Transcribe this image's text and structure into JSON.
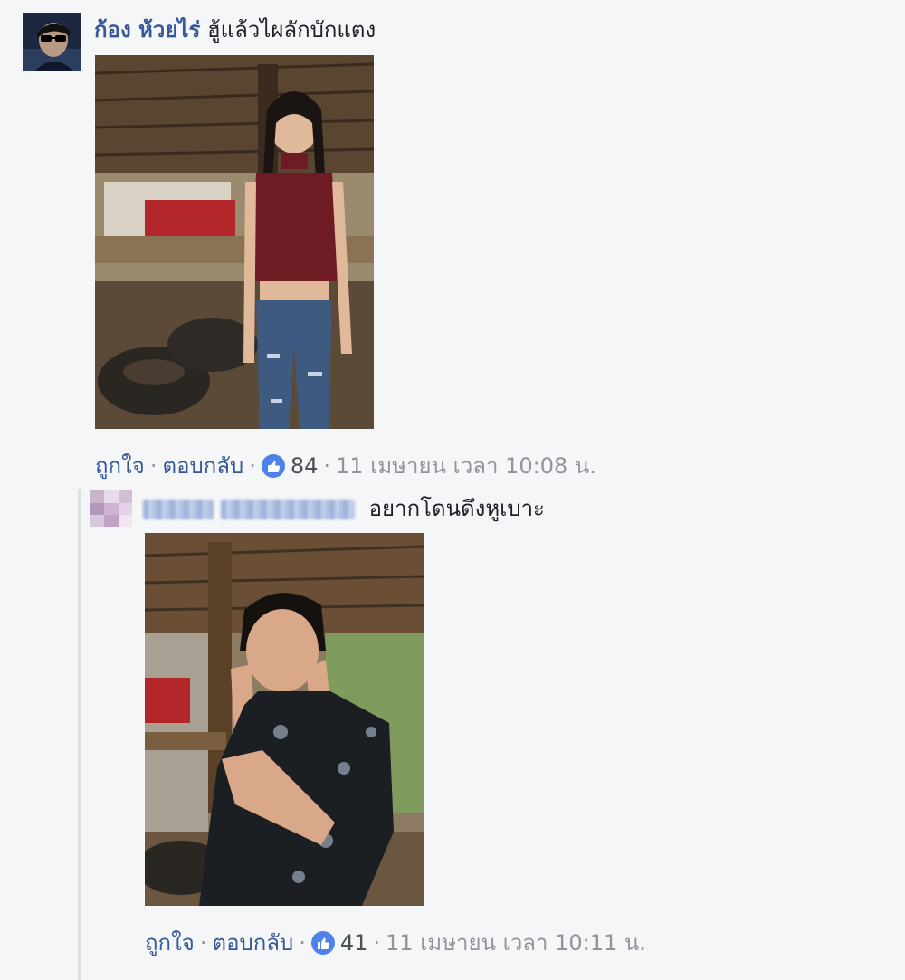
{
  "comments": [
    {
      "author": "ก้อง ห้วยไร่",
      "text": "ฮู้แล้วไผลักบักแตง",
      "actions": {
        "like_label": "ถูกใจ",
        "reply_label": "ตอบกลับ",
        "like_count": "84",
        "timestamp": "11 เมษายน เวลา 10:08 น."
      }
    },
    {
      "author": "",
      "text": "อยากโดนดึงหูเบาะ",
      "actions": {
        "like_label": "ถูกใจ",
        "reply_label": "ตอบกลับ",
        "like_count": "41",
        "timestamp": "11 เมษายน เวลา 10:11 น."
      }
    }
  ],
  "separator": "·",
  "colors": {
    "link": "#365899",
    "meta": "#90949c",
    "like_badge": "#4f82e8",
    "background": "#f5f6f8"
  },
  "icons": {
    "like": "thumbs-up-icon"
  }
}
